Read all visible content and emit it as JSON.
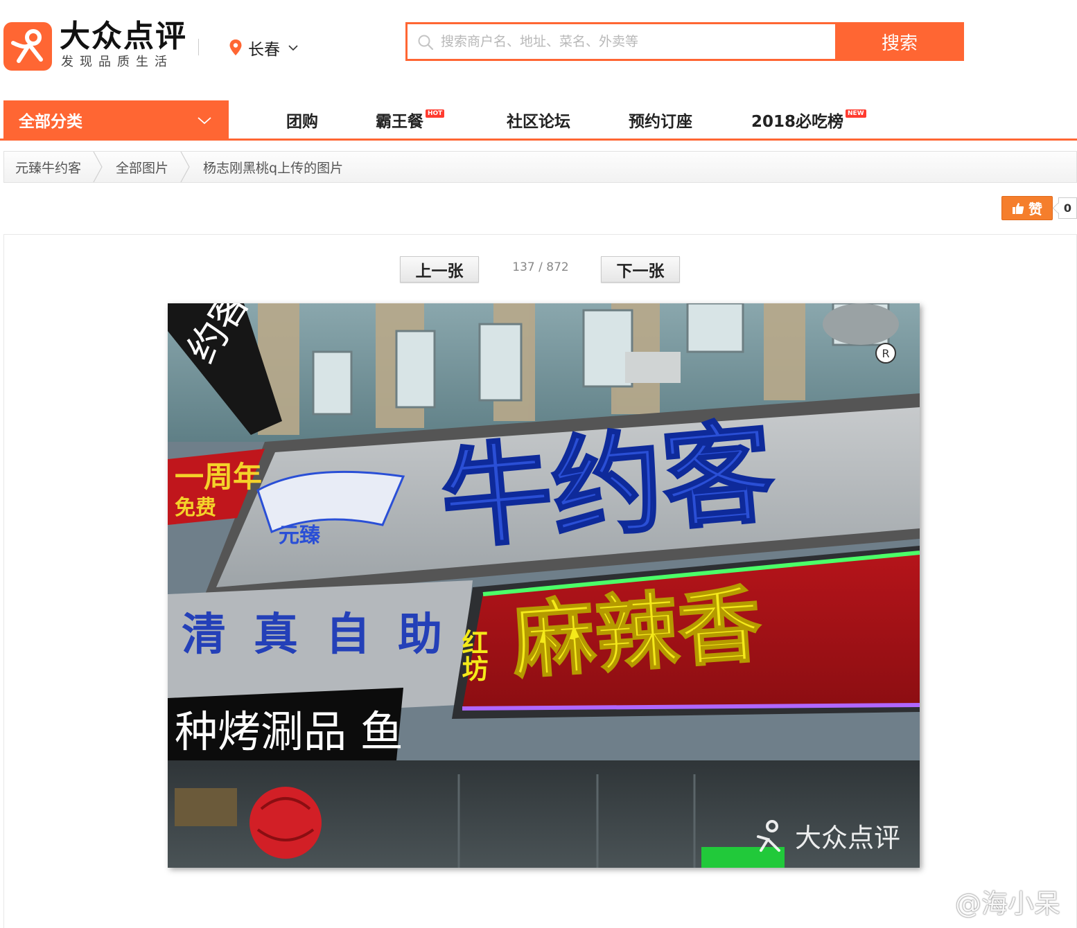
{
  "brand": {
    "name": "大众点评",
    "slogan": "发现品质生活"
  },
  "city": {
    "name": "长春"
  },
  "search": {
    "placeholder": "搜索商户名、地址、菜名、外卖等",
    "button_label": "搜索"
  },
  "nav": {
    "all_categories": "全部分类",
    "items": [
      {
        "label": "团购",
        "badge": ""
      },
      {
        "label": "霸王餐",
        "badge": "HOT"
      },
      {
        "label": "社区论坛",
        "badge": ""
      },
      {
        "label": "预约订座",
        "badge": ""
      },
      {
        "label": "2018必吃榜",
        "badge": "NEW"
      }
    ]
  },
  "breadcrumb": [
    "元臻牛约客",
    "全部图片",
    "杨志刚黑桃q上传的图片"
  ],
  "like": {
    "label": "赞",
    "count": "0"
  },
  "pager": {
    "prev_label": "上一张",
    "next_label": "下一张",
    "counter": "137 / 872"
  },
  "photo": {
    "signs": {
      "main": "牛约客",
      "red_board": "麻辣香",
      "red_board_small": "红坊",
      "blue_row": "清真自助",
      "led": "种烤涮品  鱼",
      "banner": "一周年",
      "banner_sub": "免费",
      "logo_small": "元臻",
      "left_sign": "约客自"
    },
    "watermark": "大众点评"
  },
  "weibo_watermark": "@海小呆",
  "colors": {
    "accent": "#ff6633"
  }
}
